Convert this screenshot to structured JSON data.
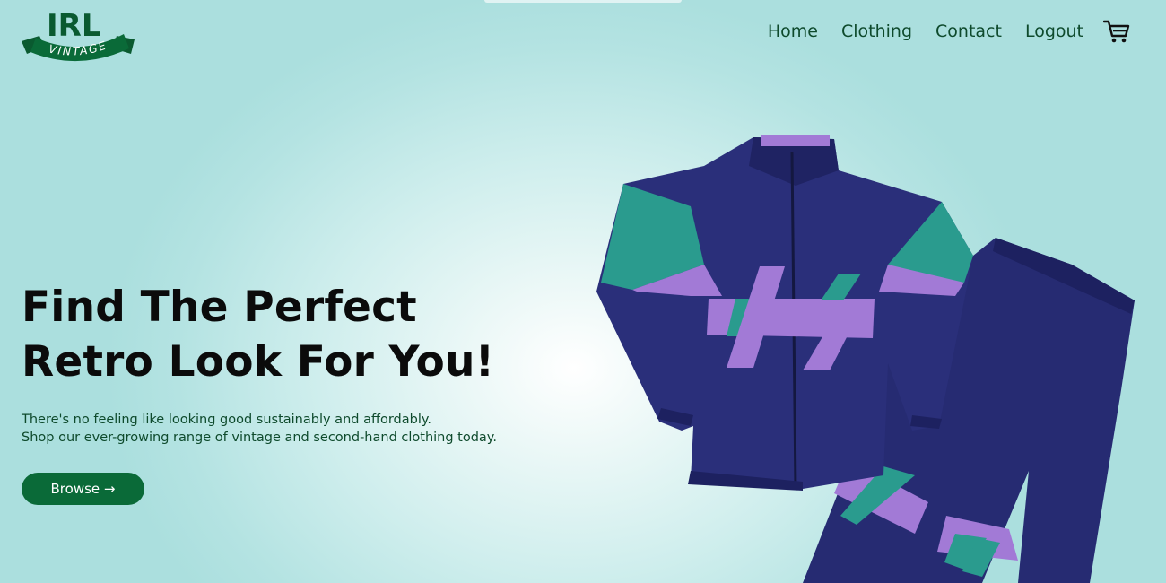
{
  "brand": {
    "logo_top": "IRL",
    "logo_banner": "VINTAGE",
    "color": "#0a6a38"
  },
  "nav": {
    "items": [
      {
        "label": "Home"
      },
      {
        "label": "Clothing"
      },
      {
        "label": "Contact"
      },
      {
        "label": "Logout"
      }
    ],
    "cart_icon": "shopping-cart-icon"
  },
  "hero": {
    "title_line1": "Find The Perfect",
    "title_line2": "Retro Look For You!",
    "subtitle_line1": "There's no feeling like looking good sustainably and affordably.",
    "subtitle_line2": "Shop our ever-growing range of vintage and second-hand clothing today.",
    "cta_label": "Browse →"
  },
  "colors": {
    "accent": "#0a6a38",
    "nav_text": "#0e4a2c",
    "jacket_navy": "#2a2f7a",
    "jacket_teal": "#2a9b8e",
    "jacket_lilac": "#a27ad6"
  }
}
